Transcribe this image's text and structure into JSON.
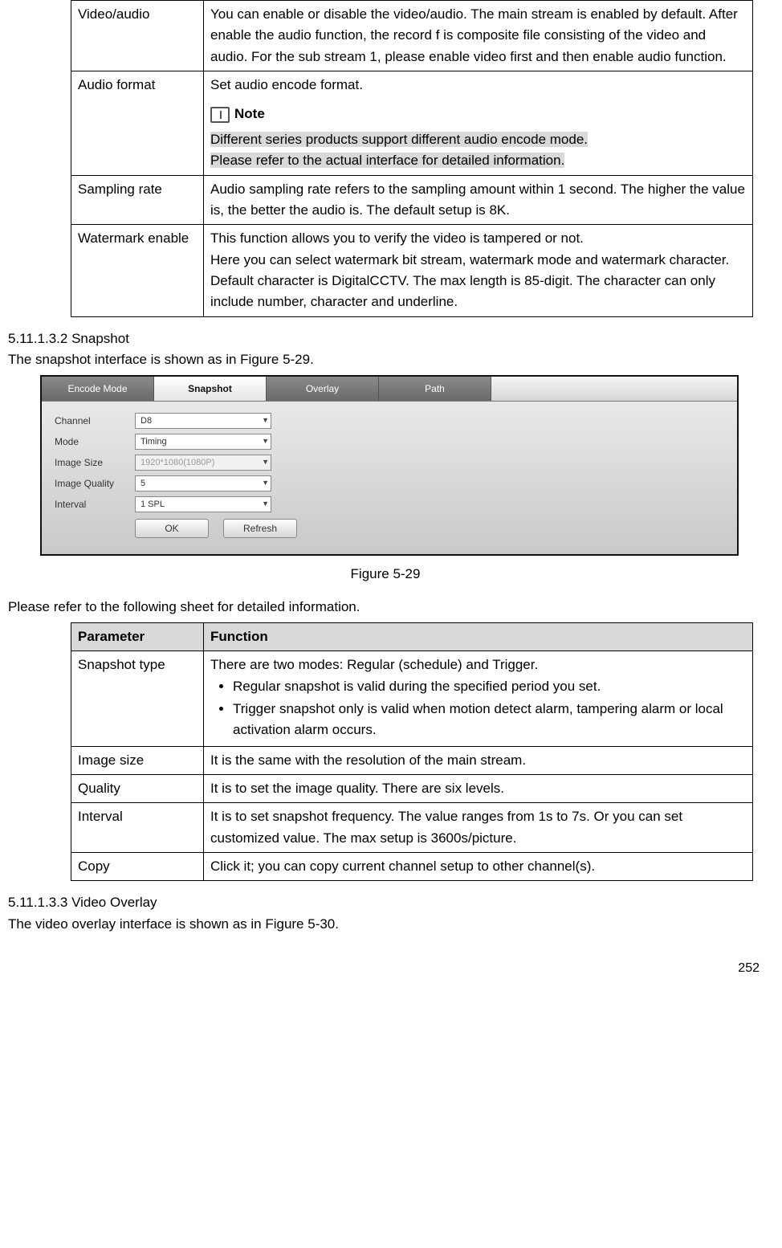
{
  "table1": {
    "rows": [
      {
        "param": "Video/audio",
        "desc": "You can enable or disable the video/audio. The main stream is enabled by default. After enable the audio function, the record f is composite file consisting of the video and audio. For the sub stream 1, please enable video first and then enable audio function."
      },
      {
        "param": "Audio format",
        "desc_intro": "Set audio encode format.",
        "note_label": "Note",
        "note_body_line1": "Different series products support different audio encode mode.",
        "note_body_line2": "Please refer to the actual interface for detailed information."
      },
      {
        "param": "Sampling rate",
        "desc": "Audio sampling rate refers to the sampling amount within 1 second. The higher the value is, the better the audio is. The default setup is 8K."
      },
      {
        "param": "Watermark enable",
        "desc_line1": "This function allows you to verify the video is tampered or not.",
        "desc_line2": "Here you can select watermark bit stream, watermark mode and watermark character. Default character is DigitalCCTV. The max length is 85-digit. The character can only include number, character and underline."
      }
    ]
  },
  "section_snapshot": {
    "heading": "5.11.1.3.2 Snapshot",
    "intro": "The snapshot interface is shown as in Figure 5-29."
  },
  "figure": {
    "tabs": [
      "Encode Mode",
      "Snapshot",
      "Overlay",
      "Path"
    ],
    "fields": [
      {
        "label": "Channel",
        "value": "D8",
        "disabled": false
      },
      {
        "label": "Mode",
        "value": "Timing",
        "disabled": false
      },
      {
        "label": "Image Size",
        "value": "1920*1080(1080P)",
        "disabled": true
      },
      {
        "label": "Image Quality",
        "value": "5",
        "disabled": false
      },
      {
        "label": "Interval",
        "value": "1 SPL",
        "disabled": false
      }
    ],
    "buttons": [
      "OK",
      "Refresh"
    ],
    "caption": "Figure 5-29"
  },
  "post_figure_text": "Please refer to the following sheet for detailed information.",
  "table2": {
    "head": {
      "c1": "Parameter",
      "c2": "Function"
    },
    "rows": [
      {
        "param": "Snapshot type",
        "intro": "There are two modes: Regular (schedule) and Trigger.",
        "bullets": [
          "Regular snapshot is valid during the specified period you set.",
          "Trigger snapshot only is valid when motion detect alarm, tampering alarm or local activation alarm occurs."
        ]
      },
      {
        "param": "Image size",
        "desc": "It is the same with the resolution of the main stream."
      },
      {
        "param": "Quality",
        "desc": "It is to set the image quality. There are six levels."
      },
      {
        "param": "Interval",
        "desc": "It is to set snapshot frequency. The value ranges from 1s to 7s. Or you can set customized value. The max setup is 3600s/picture."
      },
      {
        "param": "Copy",
        "desc": "Click it; you can copy current channel setup to other channel(s)."
      }
    ]
  },
  "section_overlay": {
    "heading": "5.11.1.3.3 Video Overlay",
    "intro": "The video overlay interface is shown as in Figure 5-30."
  },
  "page_number": "252"
}
